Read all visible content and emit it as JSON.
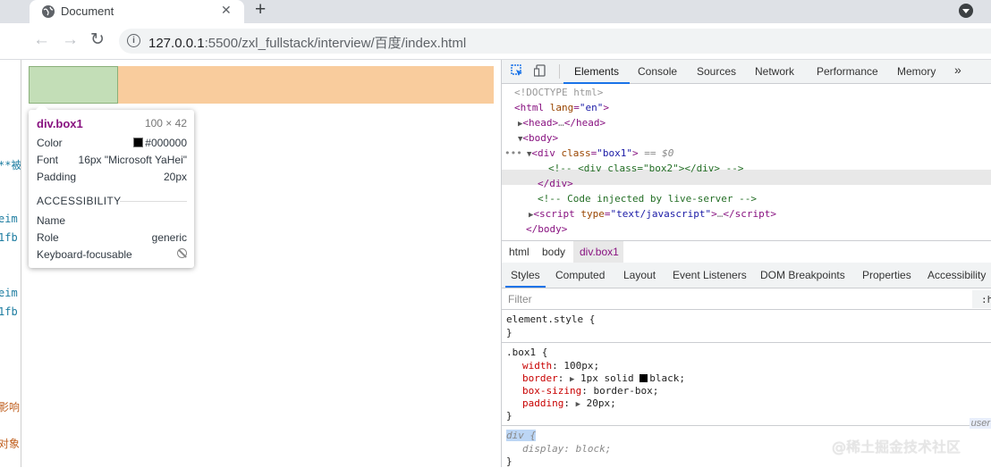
{
  "browser": {
    "tab_title": "Document",
    "tab_close": "✕",
    "new_tab": "+",
    "url_host": "127.0.0.1",
    "url_rest": ":5500/zxl_fullstack/interview/百度/index.html"
  },
  "editor_fragments": [
    "1fb",
    "**被",
    "eim",
    "1fb",
    "eim",
    "1fb",
    "影响",
    "对象"
  ],
  "tooltip": {
    "element": "div.box1",
    "size": "100 × 42",
    "color_label": "Color",
    "color_value": "#000000",
    "font_label": "Font",
    "font_value": "16px \"Microsoft YaHei\"",
    "padding_label": "Padding",
    "padding_value": "20px",
    "section": "ACCESSIBILITY",
    "name_label": "Name",
    "role_label": "Role",
    "role_value": "generic",
    "keyboard_label": "Keyboard-focusable"
  },
  "devtools": {
    "tabs": [
      "Elements",
      "Console",
      "Sources",
      "Network",
      "Performance",
      "Memory"
    ],
    "more": "»",
    "dom": {
      "doctype": "<!DOCTYPE html>",
      "html_tag": "html",
      "lang_attr": "lang",
      "lang_val": "\"en\"",
      "head": "head",
      "head_dots": "…",
      "body": "body",
      "div": "div",
      "class_attr": "class",
      "box1_val": "\"box1\"",
      "dollar": "== $0",
      "comment_box2": "<!-- <div class=\"box2\"></div> -->",
      "comment_injected": "<!-- Code injected by live-server -->",
      "script": "script",
      "type_attr": "type",
      "type_val": "\"text/javascript\"",
      "dots": "…"
    },
    "breadcrumbs": [
      "html",
      "body",
      "div.box1"
    ],
    "style_tabs": [
      "Styles",
      "Computed",
      "Layout",
      "Event Listeners",
      "DOM Breakpoints",
      "Properties",
      "Accessibility"
    ],
    "filter_placeholder": "Filter",
    "filter_right": ":h",
    "rules": {
      "element_style": "element.style {",
      "close": "}",
      "box1_sel": ".box1 {",
      "width_p": "width",
      "width_v": "100px;",
      "border_p": "border",
      "border_v": "1px solid",
      "border_c": "black;",
      "boxsizing_p": "box-sizing",
      "boxsizing_v": "border-box;",
      "padding_p": "padding",
      "padding_v": "20px;",
      "div_sel": "div {",
      "display_p": "display",
      "display_v": "block;",
      "useragent": "user"
    }
  },
  "watermark": "@稀土掘金技术社区",
  "colors": {
    "content_highlight": "#c3deb7",
    "margin_highlight": "#f9cc9d",
    "tab_active_underline": "#1a73e8"
  }
}
